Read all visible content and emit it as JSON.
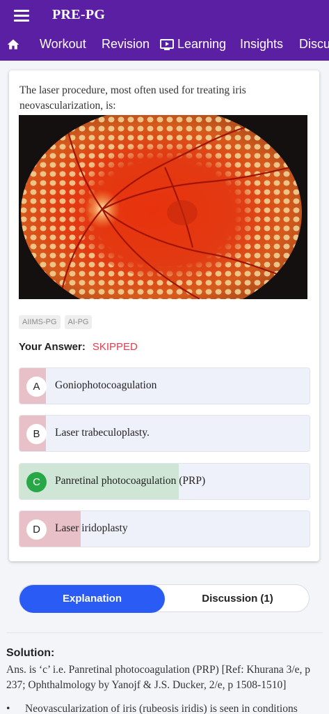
{
  "header": {
    "title": "PRE-PG",
    "menu_icon": "hamburger-menu-icon",
    "home_icon": "home-icon",
    "tabs": [
      {
        "label": "Workout"
      },
      {
        "label": "Revision"
      },
      {
        "label": "Learning",
        "icon": "play-screen-icon"
      },
      {
        "label": "Insights"
      },
      {
        "label": "Discu"
      }
    ],
    "background_color": "#5b1fa3"
  },
  "question": {
    "text": "The laser procedure, most often used for treating iris neovascularization, is:",
    "image": "fundus-photograph",
    "tags": [
      "AIIMS-PG",
      "AI-PG"
    ],
    "answer_label": "Your Answer:",
    "answer_value": "SKIPPED",
    "options": [
      {
        "letter": "A",
        "text": "Goniophotocoagulation",
        "share": 0.09,
        "correct": false
      },
      {
        "letter": "B",
        "text": "Laser trabeculoplasty.",
        "share": 0.09,
        "correct": false
      },
      {
        "letter": "C",
        "text": "Panretinal photocoagulation (PRP)",
        "share": 0.55,
        "correct": true
      },
      {
        "letter": "D",
        "text": "Laser iridoplasty",
        "share": 0.21,
        "correct": false
      }
    ]
  },
  "segmented": {
    "active": "Explanation",
    "inactive": "Discussion (1)"
  },
  "solution": {
    "title": "Solution:",
    "text": "Ans. is ‘c’ i.e. Panretinal photocoagulation (PRP) [Ref: Khurana 3/e, p 237; Ophthalmology by Yanojf & J.S. Ducker, 2/e, p 1508-1510]",
    "bullet": "Neovascularization of iris (rubeosis iridis) is seen in conditions"
  },
  "colors": {
    "accent": "#2a5cf5",
    "wrong_fill": "#e8c0c8",
    "correct_fill": "#cfe6d6",
    "skipped": "#e23b4a"
  }
}
